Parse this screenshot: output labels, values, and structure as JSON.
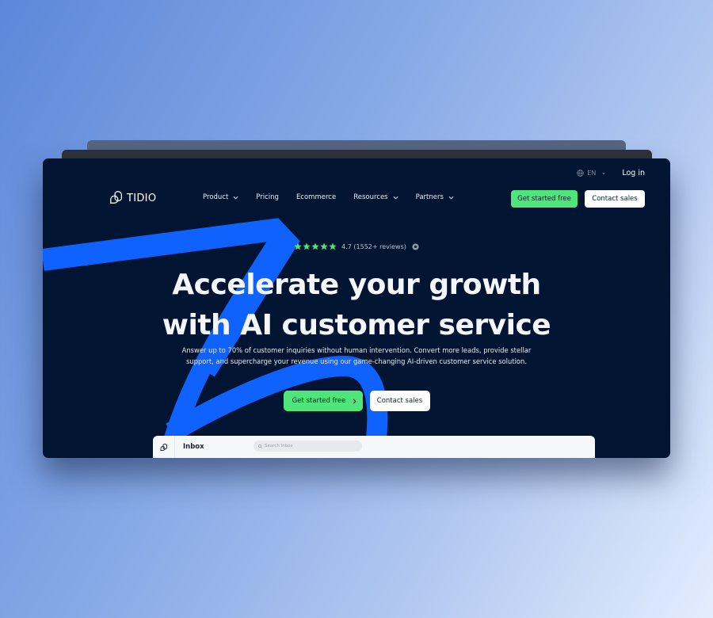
{
  "topbar": {
    "language": "EN",
    "login": "Log in"
  },
  "nav": {
    "brand": "TIDIO",
    "items": [
      {
        "label": "Product",
        "has_dropdown": true
      },
      {
        "label": "Pricing",
        "has_dropdown": false
      },
      {
        "label": "Ecommerce",
        "has_dropdown": false
      },
      {
        "label": "Resources",
        "has_dropdown": true
      },
      {
        "label": "Partners",
        "has_dropdown": true
      }
    ],
    "primary_cta": "Get started free",
    "secondary_cta": "Contact sales"
  },
  "hero": {
    "rating": {
      "stars": 5,
      "text": "4.7 (1552+ reviews)"
    },
    "headline_line1": "Accelerate your growth",
    "headline_line2": "with AI customer service",
    "subtext_line1": "Answer up to 70% of customer inquiries without human intervention. Convert more leads, provide stellar",
    "subtext_line2": "support, and supercharge your revenue using our game-changing AI-driven customer service solution.",
    "primary_cta": "Get started free",
    "secondary_cta": "Contact sales"
  },
  "inbox_preview": {
    "title": "Inbox",
    "search_placeholder": "Search Inbox"
  },
  "colors": {
    "page_bg": "#011532",
    "accent_blue": "#0f62fe",
    "cta_green": "#4fe57a",
    "star_green": "#4fe57a"
  },
  "icons": {
    "language": "globe-icon",
    "dropdown": "chevron-down-icon",
    "cta_arrow": "chevron-right-icon",
    "review_source": "g-logo-icon",
    "logo": "tidio-logo-icon",
    "inbox_rail": "tidio-logo-icon",
    "search": "search-icon"
  }
}
